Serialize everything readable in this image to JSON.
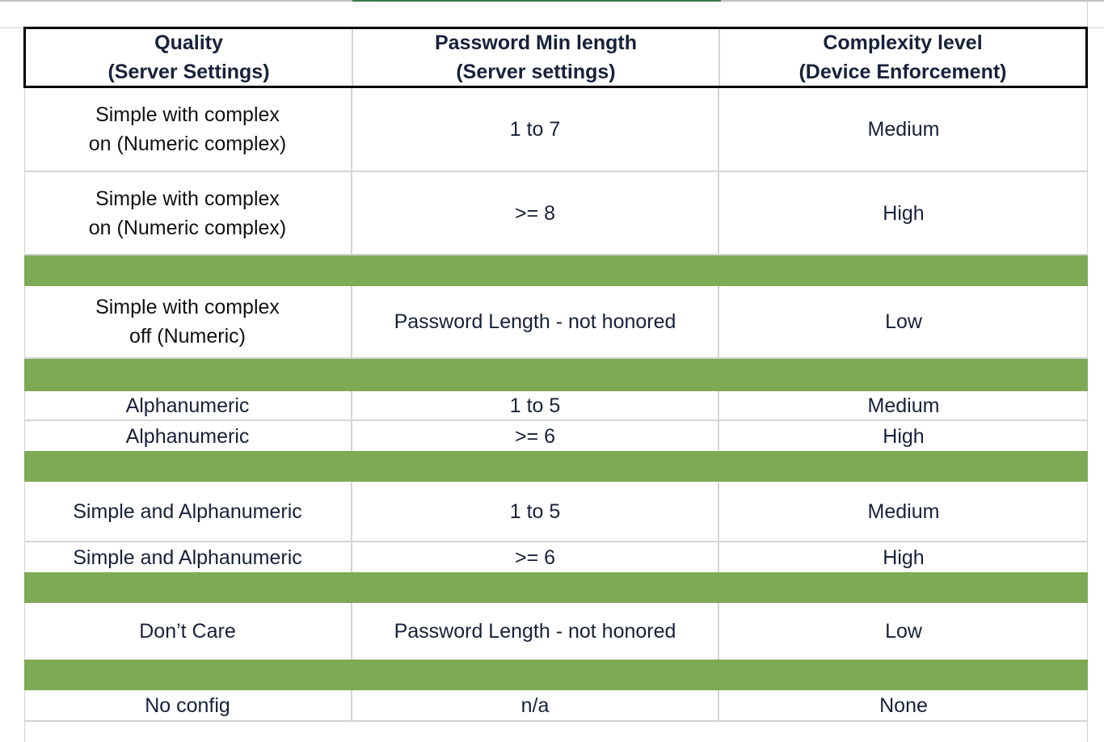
{
  "table": {
    "headers": [
      "Quality\n(Server Settings)",
      "Password Min length\n(Server settings)",
      "Complexity level\n(Device Enforcement)"
    ],
    "rows": [
      {
        "quality": "Simple with complex\non (Numeric complex)",
        "min_length": "1 to 7",
        "complexity": "Medium"
      },
      {
        "quality": "Simple with complex\non (Numeric complex)",
        "min_length": ">= 8",
        "complexity": "High"
      },
      {
        "quality": "Simple with complex\noff (Numeric)",
        "min_length": "Password Length - not honored",
        "complexity": "Low"
      },
      {
        "quality": "Alphanumeric",
        "min_length": "1 to 5",
        "complexity": "Medium"
      },
      {
        "quality": "Alphanumeric",
        "min_length": ">= 6",
        "complexity": "High"
      },
      {
        "quality": "Simple and Alphanumeric",
        "min_length": "1 to 5",
        "complexity": "Medium"
      },
      {
        "quality": "Simple and Alphanumeric",
        "min_length": ">= 6",
        "complexity": "High"
      },
      {
        "quality": "Don’t Care",
        "min_length": "Password Length - not honored",
        "complexity": "Low"
      },
      {
        "quality": "No config",
        "min_length": "n/a",
        "complexity": "None"
      }
    ]
  },
  "colors": {
    "separator_green": "#7eaa56",
    "text": "#18213a",
    "header_border": "#000000",
    "gridline": "#d4d4d4"
  }
}
